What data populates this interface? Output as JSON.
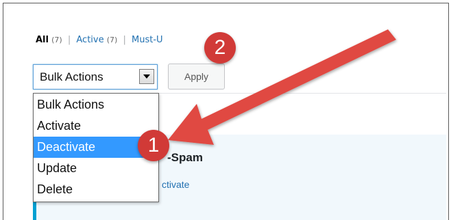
{
  "filters": {
    "all_label": "All",
    "all_count": "(7)",
    "active_label": "Active",
    "active_count": "(7)",
    "mustuse_label": "Must-U",
    "separator": "|"
  },
  "bulk_select": {
    "value": "Bulk Actions",
    "arrow_icon": "chevron-down-icon"
  },
  "apply_button": {
    "label": "Apply"
  },
  "dropdown": {
    "options": [
      "Bulk Actions",
      "Activate",
      "Deactivate",
      "Update",
      "Delete"
    ],
    "selected_index": 2
  },
  "plugin_row": {
    "name": "-Spam",
    "action": "ctivate"
  },
  "annotations": {
    "badge1": "1",
    "badge2": "2"
  },
  "colors": {
    "annotation_red": "#d13a37",
    "selected_blue": "#3399ff",
    "link_blue": "#2271b1",
    "active_bar": "#00a0d2"
  }
}
